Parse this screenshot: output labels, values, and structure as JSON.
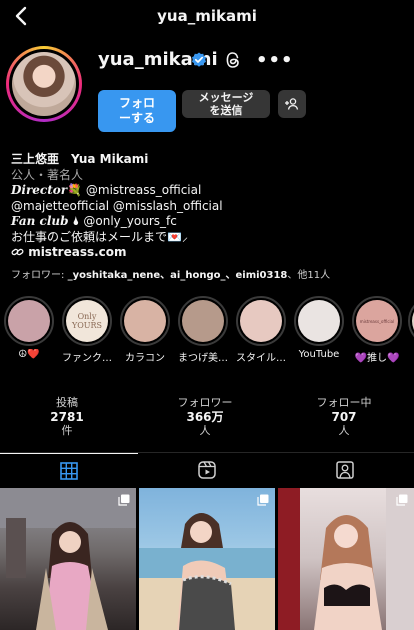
{
  "header": {
    "title": "yua_mikami"
  },
  "profile": {
    "username": "yua_mikami",
    "follow_label": "フォロ\nーする",
    "message_label": "メッセージ\nを送信"
  },
  "bio": {
    "name": "三上悠亜　Yua Mikami",
    "category": "公人・著名人",
    "director_label": "Director",
    "director_emoji": "💐",
    "director_account": " @mistreass_official",
    "line3": "@majetteofficial @misslash_official",
    "fanclub_label": "Fan club",
    "fanclub_emoji": "🌢",
    "fanclub_account": "@only_yours_fc",
    "contact": "お仕事のご依頼はメールまで💌⸝",
    "link": "mistreass.com"
  },
  "followers_line": {
    "prefix": "フォロワー: ",
    "names": "_yoshitaka_nene、ai_hongo_、eimi0318",
    "suffix": "、他11人"
  },
  "highlights": [
    {
      "label": "☮❤️",
      "color": "#c9a2a8"
    },
    {
      "label": "ファンク…",
      "color": "#f1e6da"
    },
    {
      "label": "カラコン",
      "color": "#d8b3a4"
    },
    {
      "label": "まつげ美…",
      "color": "#b69a8b"
    },
    {
      "label": "スタイル…",
      "color": "#e7c9c1"
    },
    {
      "label": "YouTube",
      "color": "#eae4e2"
    },
    {
      "label": "💜推し💜",
      "color": "#dba59e"
    }
  ],
  "highlight_overflow_color": "#e0d2c8",
  "highlight_2_text": "Only\nYOURS",
  "highlight_7_text": "mistreass_official",
  "stats": [
    {
      "label": "投稿",
      "value": "2781",
      "unit": "件"
    },
    {
      "label": "フォロワー",
      "value": "366万",
      "unit": "人"
    },
    {
      "label": "フォロー中",
      "value": "707",
      "unit": "人"
    }
  ],
  "colors": {
    "follow": "#3897f0",
    "verified": "#3897f0"
  }
}
